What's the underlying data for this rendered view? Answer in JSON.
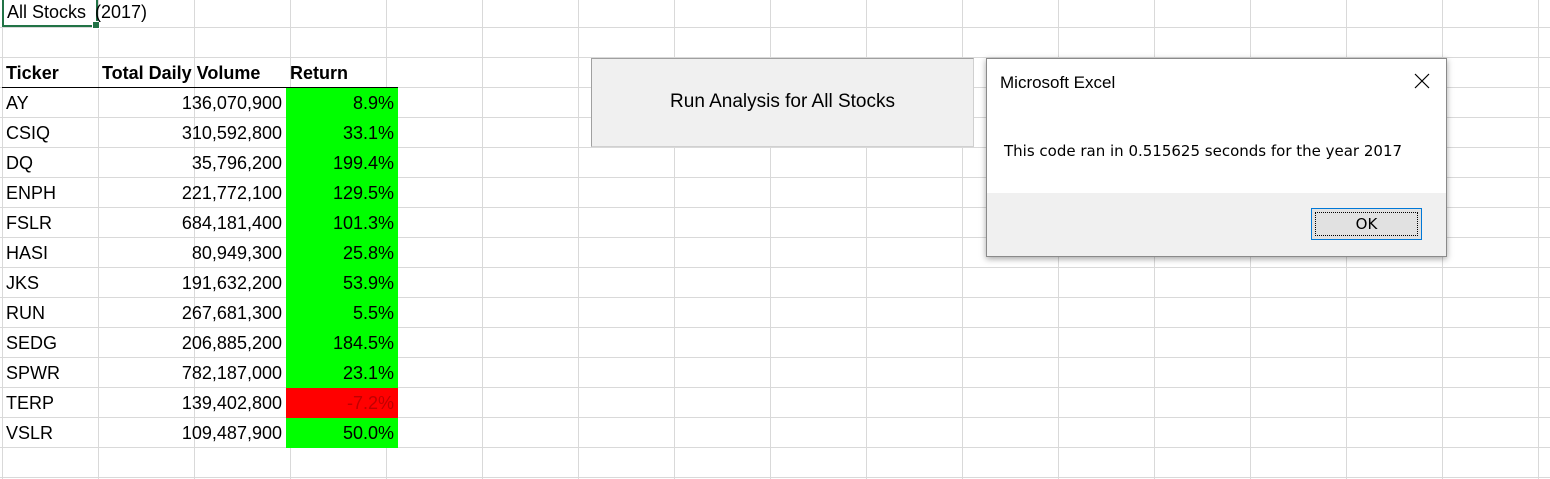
{
  "title_cell": {
    "part1": "All Stocks",
    "part2": "(2017)"
  },
  "table": {
    "headers": {
      "ticker": "Ticker",
      "volume": "Total Daily Volume",
      "return": "Return"
    },
    "rows": [
      {
        "ticker": "AY",
        "volume": "136,070,900",
        "return": "8.9%",
        "color": "#00ff00"
      },
      {
        "ticker": "CSIQ",
        "volume": "310,592,800",
        "return": "33.1%",
        "color": "#00ff00"
      },
      {
        "ticker": "DQ",
        "volume": "35,796,200",
        "return": "199.4%",
        "color": "#00ff00"
      },
      {
        "ticker": "ENPH",
        "volume": "221,772,100",
        "return": "129.5%",
        "color": "#00ff00"
      },
      {
        "ticker": "FSLR",
        "volume": "684,181,400",
        "return": "101.3%",
        "color": "#00ff00"
      },
      {
        "ticker": "HASI",
        "volume": "80,949,300",
        "return": "25.8%",
        "color": "#00ff00"
      },
      {
        "ticker": "JKS",
        "volume": "191,632,200",
        "return": "53.9%",
        "color": "#00ff00"
      },
      {
        "ticker": "RUN",
        "volume": "267,681,300",
        "return": "5.5%",
        "color": "#00ff00"
      },
      {
        "ticker": "SEDG",
        "volume": "206,885,200",
        "return": "184.5%",
        "color": "#00ff00"
      },
      {
        "ticker": "SPWR",
        "volume": "782,187,000",
        "return": "23.1%",
        "color": "#00ff00"
      },
      {
        "ticker": "TERP",
        "volume": "139,402,800",
        "return": "-7.2%",
        "color": "#ff0000"
      },
      {
        "ticker": "VSLR",
        "volume": "109,487,900",
        "return": "50.0%",
        "color": "#00ff00"
      }
    ]
  },
  "run_button": {
    "label": "Run Analysis for All Stocks"
  },
  "dialog": {
    "title": "Microsoft Excel",
    "message": "This code ran in 0.515625 seconds for the year 2017",
    "ok_label": "OK",
    "close_icon": "close-icon"
  },
  "colors": {
    "positive": "#00ff00",
    "negative": "#ff0000",
    "selection": "#217346",
    "ok_border": "#0078d7"
  }
}
